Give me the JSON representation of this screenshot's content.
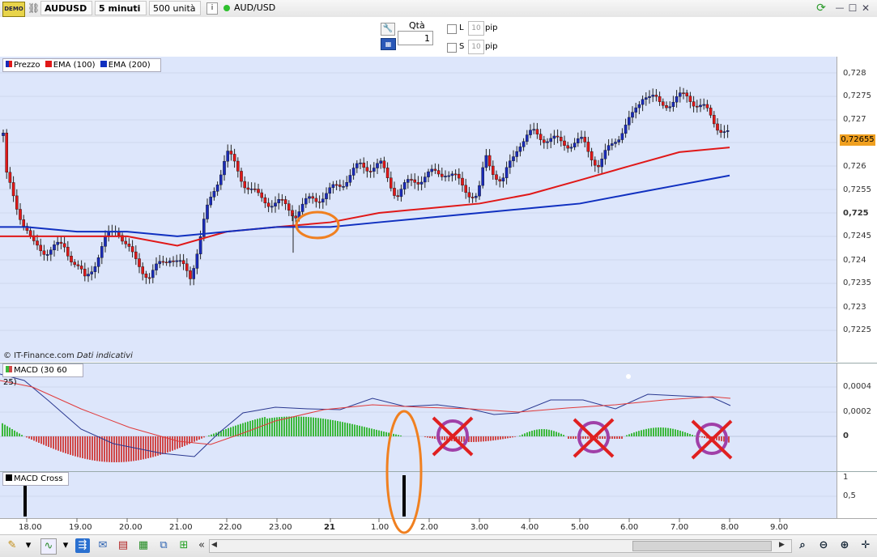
{
  "toolbar": {
    "demo_label": "DEMO",
    "symbol": "AUDUSD",
    "timeframe": "5 minuti",
    "units": "500 unità",
    "instrument": "AUD/USD",
    "window_controls": [
      "—",
      "☐",
      "✕"
    ]
  },
  "order": {
    "qty_label": "Qtà",
    "qty_value": "1",
    "l_label": "L",
    "s_label": "S",
    "l_value": "10",
    "s_value": "10",
    "pip_label": "pip"
  },
  "legend": {
    "price": "Prezzo",
    "ema100": "EMA (100)",
    "ema200": "EMA (200)",
    "macd": "MACD (30 60 25)",
    "macdcross": "MACD Cross",
    "colors": {
      "price": "#1a2bb8",
      "ema100": "#e01818",
      "ema200": "#1030c0",
      "macd_pos": "#3cb83c",
      "macd_neg": "#d04848"
    }
  },
  "footer_note": {
    "source": "© IT-Finance.com",
    "disclaimer": "Dati indicativi"
  },
  "price_axis": {
    "labels": [
      "0,728",
      "0,7275",
      "0,727",
      "0,7265",
      "0,726",
      "0,7255",
      "0,725",
      "0,7245",
      "0,724",
      "0,7235",
      "0,723",
      "0,7225"
    ],
    "current": "0,72655"
  },
  "macd_axis": {
    "labels": [
      "0,0004",
      "0,0002",
      "0"
    ]
  },
  "cross_axis": {
    "labels": [
      "1",
      "0,5"
    ]
  },
  "time_axis": {
    "labels": [
      "18.00",
      "19.00",
      "20.00",
      "21.00",
      "22.00",
      "23.00",
      "21",
      "1.00",
      "2.00",
      "3.00",
      "4.00",
      "5.00",
      "6.00",
      "7.00",
      "8.00",
      "9.00"
    ]
  },
  "chart_data": {
    "type": "line",
    "title": "",
    "symbol": "AUD/USD",
    "timeframe": "5 minuti",
    "ylim": [
      0.72225,
      0.72815
    ],
    "x": [
      "18.00",
      "19.00",
      "20.00",
      "21.00",
      "22.00",
      "23.00",
      "21",
      "1.00",
      "2.00",
      "3.00",
      "4.00",
      "5.00",
      "6.00",
      "7.00",
      "8.00"
    ],
    "series": [
      {
        "name": "Prezzo",
        "values": [
          0.7245,
          0.724,
          0.724,
          0.7242,
          0.7262,
          0.7252,
          0.7252,
          0.7258,
          0.7258,
          0.7254,
          0.7266,
          0.7262,
          0.7275,
          0.7272,
          0.72655
        ]
      },
      {
        "name": "EMA (100)",
        "values": [
          0.7245,
          0.7245,
          0.7245,
          0.7243,
          0.7246,
          0.7247,
          0.7248,
          0.725,
          0.7251,
          0.7252,
          0.7254,
          0.7257,
          0.726,
          0.7263,
          0.7264
        ]
      },
      {
        "name": "EMA (200)",
        "values": [
          0.7247,
          0.7246,
          0.7246,
          0.7245,
          0.7246,
          0.7247,
          0.7247,
          0.7248,
          0.7249,
          0.725,
          0.7251,
          0.7252,
          0.7254,
          0.7256,
          0.7258
        ]
      }
    ]
  }
}
